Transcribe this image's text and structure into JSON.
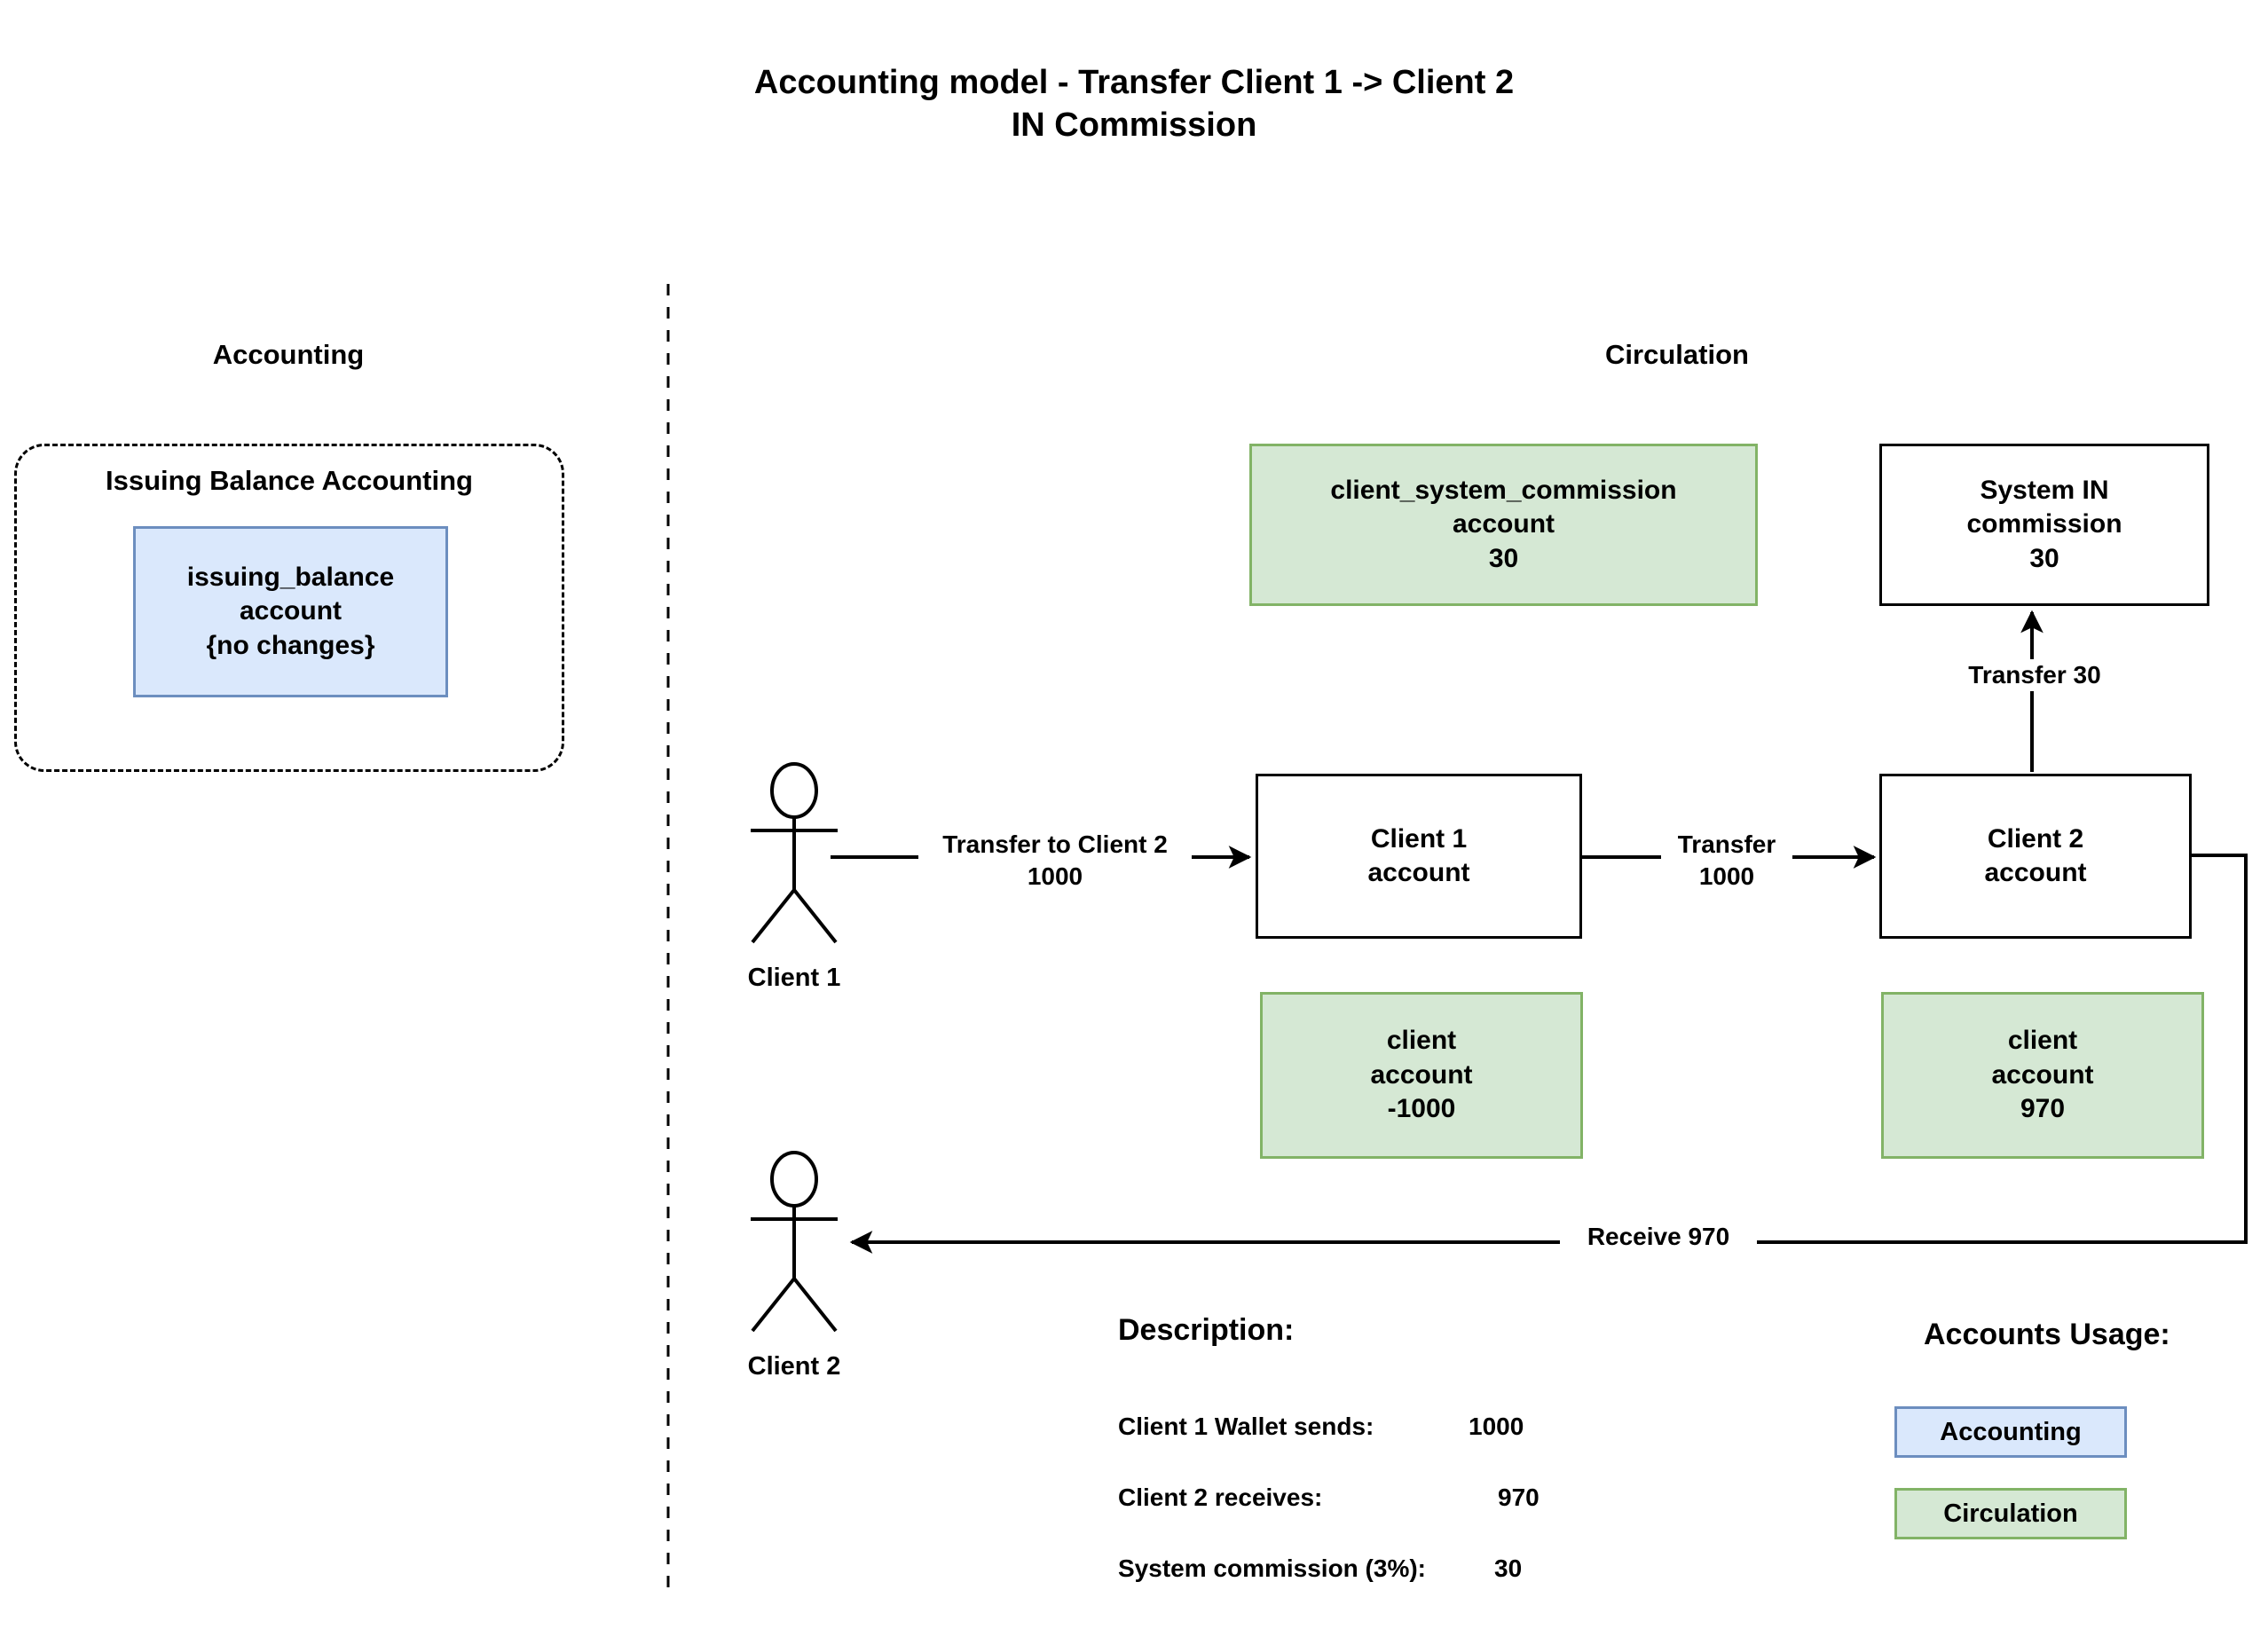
{
  "title": {
    "line1": "Accounting model - Transfer Client 1 -> Client 2",
    "line2": "IN Commission"
  },
  "zones": {
    "accounting": "Accounting",
    "circulation": "Circulation"
  },
  "accounting_group": {
    "title": "Issuing Balance Accounting",
    "account": {
      "name": "issuing_balance",
      "kind": "account",
      "value": "{no changes}"
    }
  },
  "nodes": {
    "client_system_commission": {
      "name": "client_system_commission",
      "kind": "account",
      "value": "30"
    },
    "system_in_commission": {
      "line1": "System IN",
      "line2": "commission",
      "value": "30"
    },
    "client1_account": {
      "line1": "Client 1",
      "line2": "account"
    },
    "client2_account": {
      "line1": "Client 2",
      "line2": "account"
    },
    "client1_balance": {
      "name": "client",
      "kind": "account",
      "value": "-1000"
    },
    "client2_balance": {
      "name": "client",
      "kind": "account",
      "value": "970"
    }
  },
  "actors": {
    "client1": "Client 1",
    "client2": "Client 2"
  },
  "edges": {
    "transfer_to_client2": {
      "line1": "Transfer to Client 2",
      "line2": "1000"
    },
    "transfer": {
      "line1": "Transfer",
      "line2": "1000"
    },
    "transfer_30": {
      "line1": "Transfer 30"
    },
    "receive_970": {
      "line1": "Receive 970"
    }
  },
  "description": {
    "heading": "Description:",
    "rows": [
      {
        "key": "Client 1 Wallet sends:",
        "value": "1000"
      },
      {
        "key": "Client 2 receives:",
        "value": "970"
      },
      {
        "key": "System commission (3%):",
        "value": "30"
      }
    ]
  },
  "accounts_usage": {
    "heading": "Accounts Usage:",
    "items": [
      {
        "label": "Accounting",
        "fill": "#dae8fc",
        "stroke": "#6c8ebf"
      },
      {
        "label": "Circulation",
        "fill": "#d5e8d4",
        "stroke": "#82b366"
      }
    ]
  },
  "colors": {
    "circulation_fill": "#d5e8d4",
    "circulation_stroke": "#82b366",
    "accounting_fill": "#dae8fc",
    "accounting_stroke": "#6c8ebf",
    "line": "#000000",
    "background": "#ffffff"
  }
}
